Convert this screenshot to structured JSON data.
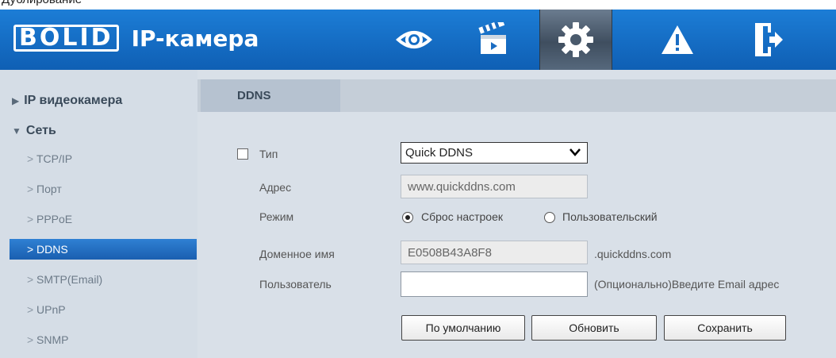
{
  "top_fragment": "Дублирование",
  "header": {
    "logo_text": "BOLID",
    "title": "IP-камера",
    "nav": [
      {
        "name": "live-view",
        "icon": "eye-icon"
      },
      {
        "name": "playback",
        "icon": "clapperboard-icon"
      },
      {
        "name": "settings",
        "icon": "gear-icon",
        "active": true
      },
      {
        "name": "alarm",
        "icon": "warning-icon"
      },
      {
        "name": "logout",
        "icon": "exit-icon"
      }
    ]
  },
  "sidebar": {
    "groups": [
      {
        "label": "IP видеокамера",
        "expanded": false
      },
      {
        "label": "Сеть",
        "expanded": true
      }
    ],
    "items": [
      "TCP/IP",
      "Порт",
      "PPPoE",
      "DDNS",
      "SMTP(Email)",
      "UPnP",
      "SNMP"
    ],
    "active_item": "DDNS"
  },
  "main": {
    "tab": "DDNS",
    "form": {
      "type_label": "Тип",
      "type_enabled": false,
      "type_value": "Quick DDNS",
      "address_label": "Адрес",
      "address_value": "www.quickddns.com",
      "mode_label": "Режим",
      "mode_options": [
        "Сброс настроек",
        "Пользовательский"
      ],
      "mode_selected": "Сброс настроек",
      "domain_label": "Доменное имя",
      "domain_value": "E0508B43A8F8",
      "domain_suffix": ".quickddns.com",
      "user_label": "Пользователь",
      "user_value": "",
      "user_hint": "(Опционально)Введите Email адрес"
    },
    "buttons": {
      "default": "По умолчанию",
      "refresh": "Обновить",
      "save": "Сохранить"
    }
  },
  "colors": {
    "header_blue": "#1a72c9",
    "sidebar_bg": "#d5dde6",
    "main_bg": "#d9e0e8",
    "active_item": "#2673c6"
  }
}
